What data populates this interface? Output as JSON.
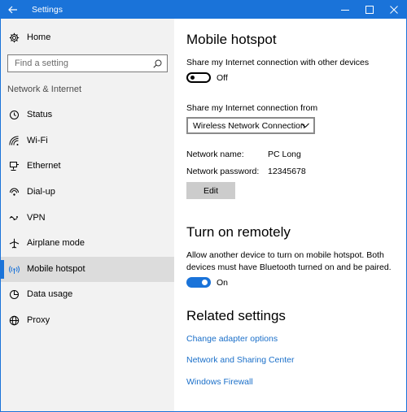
{
  "window": {
    "title": "Settings"
  },
  "sidebar": {
    "home_label": "Home",
    "search_placeholder": "Find a setting",
    "section_label": "Network & Internet",
    "items": [
      {
        "label": "Status",
        "icon": "status-icon"
      },
      {
        "label": "Wi-Fi",
        "icon": "wifi-icon"
      },
      {
        "label": "Ethernet",
        "icon": "ethernet-icon"
      },
      {
        "label": "Dial-up",
        "icon": "dialup-icon"
      },
      {
        "label": "VPN",
        "icon": "vpn-icon"
      },
      {
        "label": "Airplane mode",
        "icon": "airplane-icon"
      },
      {
        "label": "Mobile hotspot",
        "icon": "hotspot-icon",
        "selected": true
      },
      {
        "label": "Data usage",
        "icon": "data-usage-icon"
      },
      {
        "label": "Proxy",
        "icon": "globe-icon"
      }
    ]
  },
  "main": {
    "title": "Mobile hotspot",
    "share_label": "Share my Internet connection with other devices",
    "share_toggle_state": "Off",
    "share_from_label": "Share my Internet connection from",
    "share_from_value": "Wireless Network Connection",
    "network_name_label": "Network name:",
    "network_name_value": "PC Long",
    "network_password_label": "Network password:",
    "network_password_value": "12345678",
    "edit_button": "Edit",
    "remote_title": "Turn on remotely",
    "remote_desc_line1": "Allow another device to turn on mobile hotspot. Both",
    "remote_desc_line2": "devices must have Bluetooth turned on and be paired.",
    "remote_toggle_state": "On",
    "related_title": "Related settings",
    "links": [
      "Change adapter options",
      "Network and Sharing Center",
      "Windows Firewall"
    ]
  },
  "colors": {
    "accent": "#1a73d9",
    "link": "#1a6fc9",
    "sidebar_bg": "#f2f2f2",
    "selected_bg": "#dcdcdc"
  }
}
